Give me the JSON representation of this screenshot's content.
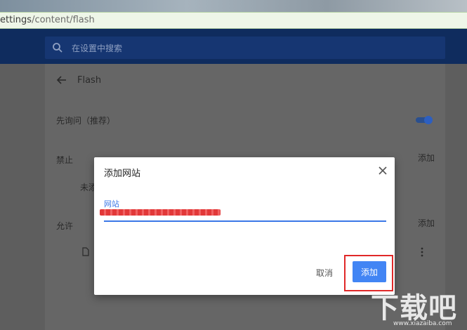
{
  "address_bar": {
    "url_main": "ettings",
    "url_rest": "/content/flash"
  },
  "search": {
    "placeholder": "在设置中搜索"
  },
  "page": {
    "title": "Flash",
    "toggle_label": "先询问（推荐）",
    "block_label": "禁止",
    "block_empty": "未添",
    "allow_label": "允许",
    "add_link_block": "添加",
    "add_link_allow": "添加"
  },
  "dialog": {
    "title": "添加网站",
    "field_label": "网站",
    "field_value": "",
    "cancel_label": "取消",
    "add_label": "添加"
  },
  "watermark": {
    "logo": "下载吧",
    "url": "www.xiazaiba.com"
  },
  "colors": {
    "accent": "#4285f4",
    "header": "#0f2c5e",
    "highlight": "#e02828"
  }
}
